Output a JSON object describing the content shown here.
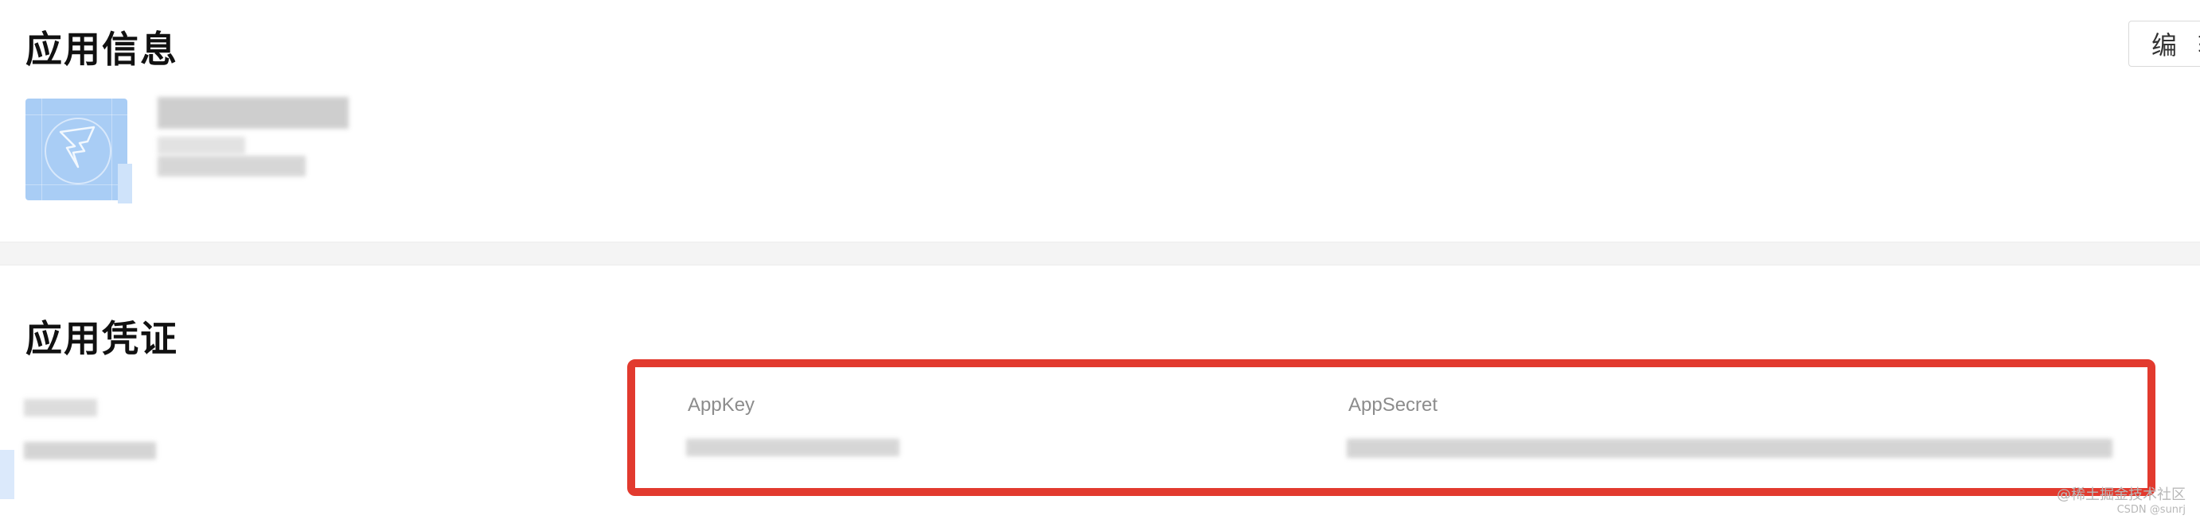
{
  "app_info": {
    "title": "应用信息",
    "edit_label": "编 辑"
  },
  "credentials": {
    "title": "应用凭证",
    "app_key_label": "AppKey",
    "app_secret_label": "AppSecret"
  },
  "icons": {
    "app_logo": "dingtalk-style-logo-icon"
  },
  "colors": {
    "highlight_border": "#e23a2e",
    "app_icon_bg": "#a9cdf5"
  },
  "watermark": {
    "line1": "@稀土掘金技术社区",
    "line2": "CSDN @sunrj"
  }
}
